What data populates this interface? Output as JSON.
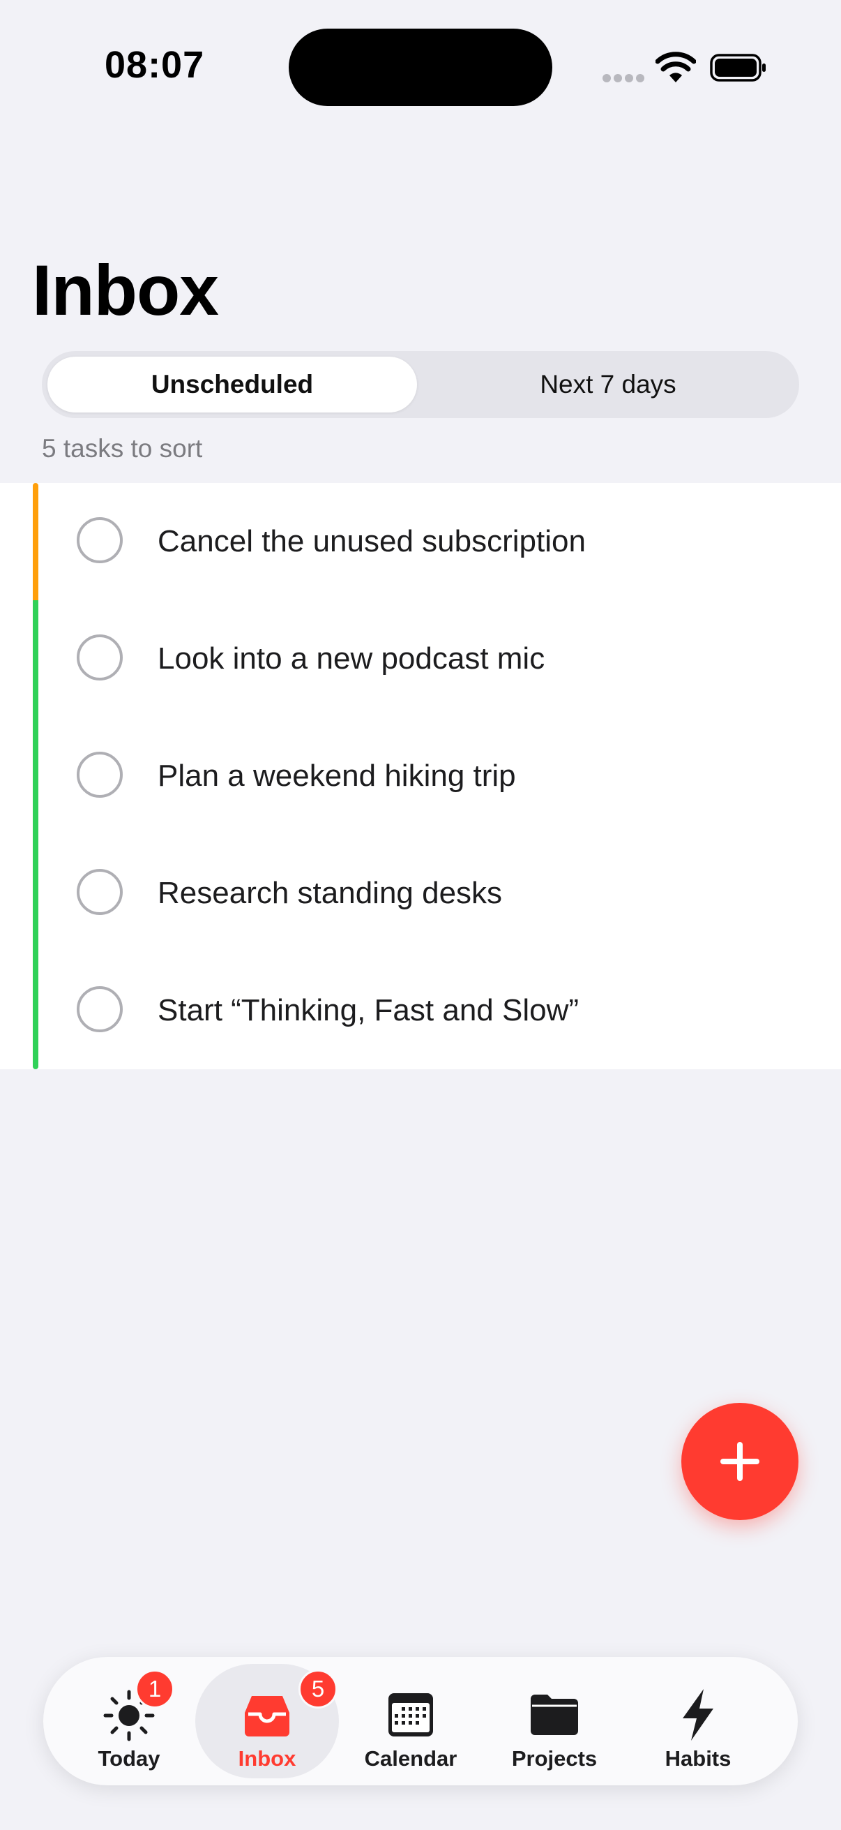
{
  "status_bar": {
    "time": "08:07"
  },
  "header": {
    "title": "Inbox"
  },
  "segments": {
    "active": "Unscheduled",
    "inactive": "Next 7 days"
  },
  "summary": "5 tasks to sort",
  "tasks": [
    {
      "title": "Cancel the unused subscription",
      "priority_color": "#FF9F0A"
    },
    {
      "title": "Look into a new podcast mic",
      "priority_color": "#30D158"
    },
    {
      "title": "Plan a weekend hiking trip",
      "priority_color": "#30D158"
    },
    {
      "title": "Research standing desks",
      "priority_color": "#30D158"
    },
    {
      "title": "Start “Thinking, Fast and Slow”",
      "priority_color": "#30D158"
    }
  ],
  "fab": {
    "icon": "plus-icon"
  },
  "tabbar": {
    "tabs": [
      {
        "label": "Today",
        "icon": "sun-icon",
        "badge": "1"
      },
      {
        "label": "Inbox",
        "icon": "inbox-tray-icon",
        "badge": "5",
        "selected": true
      },
      {
        "label": "Calendar",
        "icon": "calendar-icon"
      },
      {
        "label": "Projects",
        "icon": "folder-icon"
      },
      {
        "label": "Habits",
        "icon": "bolt-icon"
      }
    ]
  },
  "colors": {
    "accent": "#FF3B30",
    "background": "#F2F2F7"
  }
}
